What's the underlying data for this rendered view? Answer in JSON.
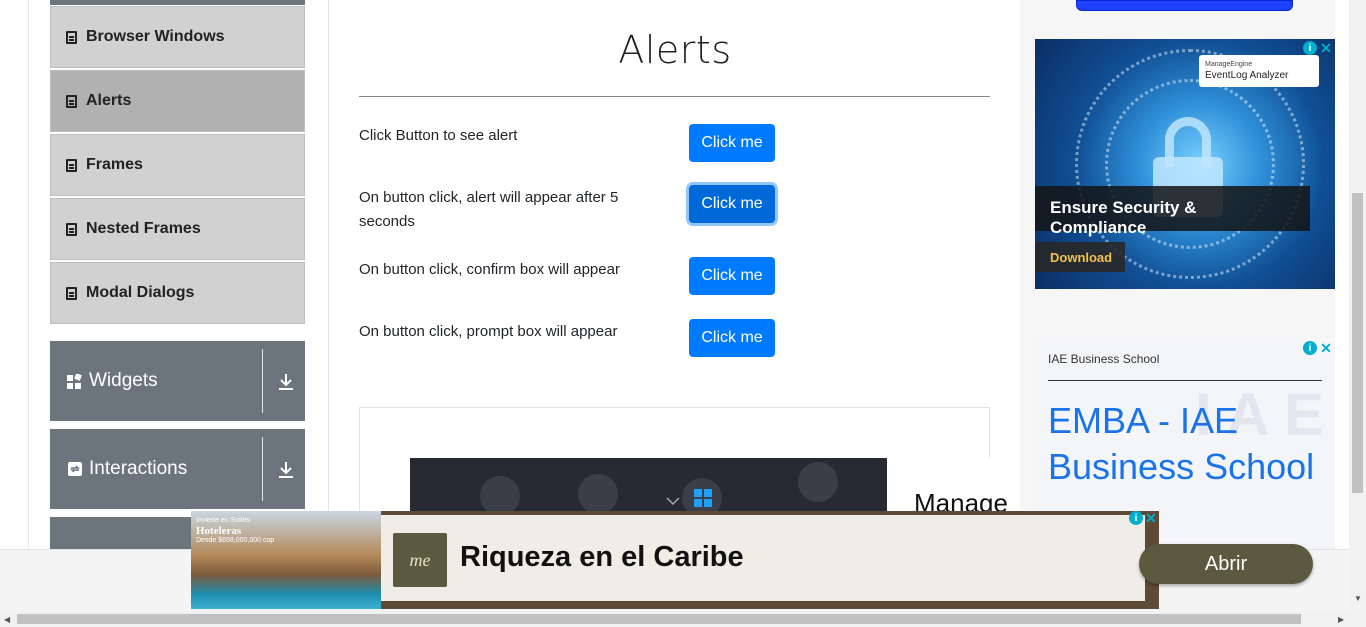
{
  "sidebar": {
    "items": [
      {
        "label": "Browser Windows",
        "active": false
      },
      {
        "label": "Alerts",
        "active": true
      },
      {
        "label": "Frames",
        "active": false
      },
      {
        "label": "Nested Frames",
        "active": false
      },
      {
        "label": "Modal Dialogs",
        "active": false
      }
    ],
    "groups": [
      {
        "label": "Widgets",
        "icon": "widgets-icon"
      },
      {
        "label": "Interactions",
        "icon": "interactions-icon"
      }
    ]
  },
  "main": {
    "title": "Alerts",
    "rows": [
      {
        "label": "Click Button to see alert",
        "button": "Click me"
      },
      {
        "label": "On button click, alert will appear after 5 seconds",
        "button": "Click me"
      },
      {
        "label": "On button click, confirm box will appear",
        "button": "Click me"
      },
      {
        "label": "On button click, prompt box will appear",
        "button": "Click me"
      }
    ],
    "partial_ad_text": "Manage"
  },
  "ads": {
    "right_top": {
      "brand_small": "ManageEngine",
      "brand": "EventLog Analyzer",
      "headline": "Ensure Security & Compliance",
      "cta": "Download"
    },
    "right_bottom": {
      "advertiser": "IAE Business School",
      "headline": "EMBA - IAE Business School"
    },
    "banner": {
      "photo_caption_top": "Invierte en Suites",
      "photo_caption_main": "Hoteleras",
      "photo_caption_sub": "Desde $658,000,000 cop",
      "logo_text": "me",
      "title": "Riqueza en el Caribe",
      "cta": "Abrir"
    }
  },
  "colors": {
    "primary": "#007bff",
    "sidebar_item": "#d1d1d1",
    "sidebar_active": "#b1b1b1",
    "group_bg": "#6c757d",
    "banner_cta": "#5b5a41"
  }
}
